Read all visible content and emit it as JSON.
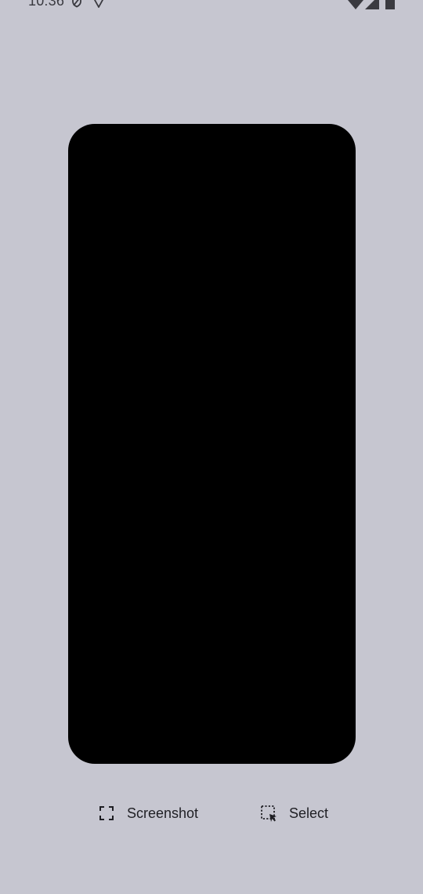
{
  "status_bar": {
    "time": "10:36",
    "left_icons": [
      "vpn-shield-icon",
      "location-pin-icon"
    ],
    "right_icons": [
      "wifi-icon",
      "signal-icon",
      "battery-icon"
    ]
  },
  "preview": {
    "background_color": "#000000"
  },
  "actions": {
    "screenshot": {
      "label": "Screenshot",
      "icon": "screenshot-frame-icon"
    },
    "select": {
      "label": "Select",
      "icon": "select-region-icon"
    }
  },
  "colors": {
    "background": "#c6c6d0",
    "text": "#1f1f24"
  }
}
